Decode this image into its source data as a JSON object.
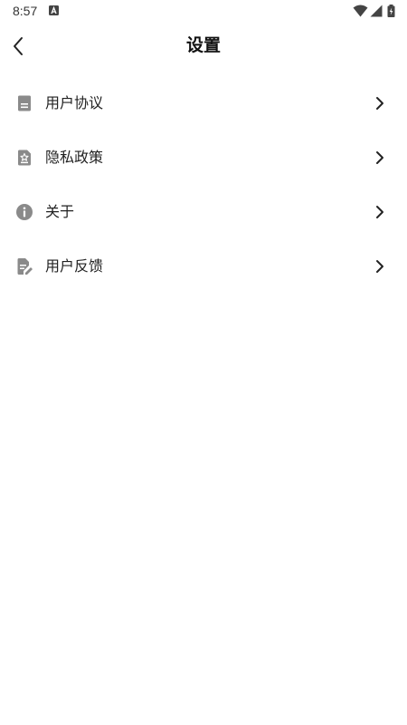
{
  "status_bar": {
    "time": "8:57",
    "notification_icon": "a-letter-icon",
    "wifi_icon": "wifi-icon",
    "signal_icon": "cell-signal-icon",
    "battery_icon": "battery-charging-icon"
  },
  "header": {
    "title": "设置",
    "back_icon": "chevron-left-icon"
  },
  "menu": {
    "items": [
      {
        "label": "用户协议",
        "icon": "document-icon"
      },
      {
        "label": "隐私政策",
        "icon": "privacy-star-document-icon"
      },
      {
        "label": "关于",
        "icon": "info-icon"
      },
      {
        "label": "用户反馈",
        "icon": "feedback-edit-icon"
      }
    ],
    "chevron_icon": "chevron-right-icon"
  },
  "colors": {
    "icon_gray": "#8a8a8a",
    "text": "#222222",
    "background": "#ffffff"
  }
}
